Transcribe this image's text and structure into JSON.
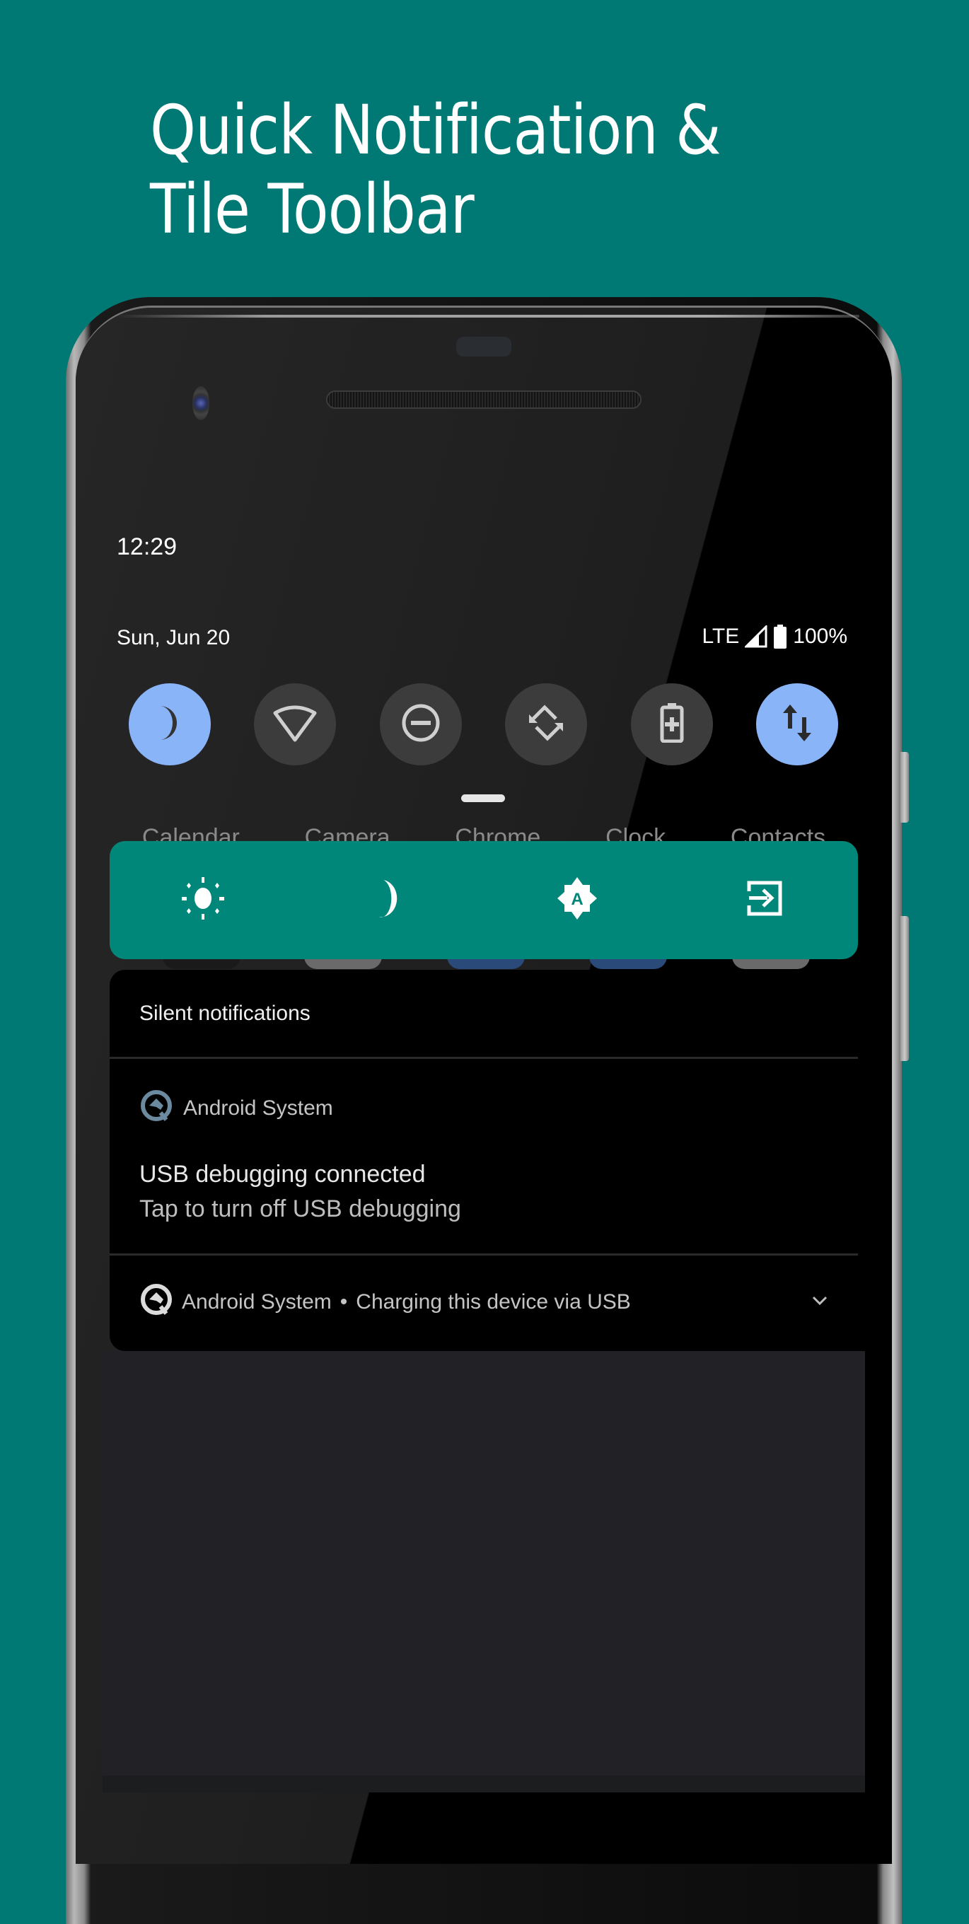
{
  "headline": {
    "line1": "Quick Notification &",
    "line2": "Tile Toolbar"
  },
  "colors": {
    "background": "#007873",
    "toolbar": "#00877a",
    "tile_active": "#8ab4f8",
    "tile_inactive": "#3c3c3c"
  },
  "status_bar": {
    "time": "12:29",
    "date": "Sun, Jun 20",
    "network": "LTE",
    "battery": "100%"
  },
  "quick_tiles": [
    {
      "icon": "moon-icon",
      "label": "Dark theme",
      "active": true
    },
    {
      "icon": "wifi-icon",
      "label": "Wi-Fi",
      "active": false
    },
    {
      "icon": "do-not-disturb-icon",
      "label": "Do Not Disturb",
      "active": false
    },
    {
      "icon": "auto-rotate-icon",
      "label": "Auto-rotate",
      "active": false
    },
    {
      "icon": "battery-saver-icon",
      "label": "Battery Saver",
      "active": false
    },
    {
      "icon": "mobile-data-icon",
      "label": "Mobile data",
      "active": true
    }
  ],
  "background_app_labels": [
    "Calendar",
    "Camera",
    "Chrome",
    "Clock",
    "Contacts"
  ],
  "toolbar": {
    "buttons": [
      {
        "icon": "brightness-icon"
      },
      {
        "icon": "night-mode-icon"
      },
      {
        "icon": "auto-brightness-icon",
        "glyph": "A"
      },
      {
        "icon": "exit-icon"
      }
    ]
  },
  "notifications": {
    "section_title": "Silent notifications",
    "items": [
      {
        "app": "Android System",
        "title": "USB debugging connected",
        "text": "Tap to turn off USB debugging"
      },
      {
        "app": "Android System",
        "separator": "•",
        "summary": "Charging this device via USB"
      }
    ]
  }
}
